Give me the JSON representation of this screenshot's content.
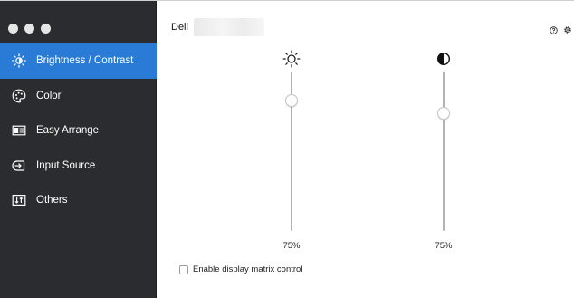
{
  "window": {
    "controls": [
      "close",
      "minimize",
      "zoom"
    ]
  },
  "sidebar": {
    "items": [
      {
        "label": "Brightness / Contrast",
        "icon": "brightness-icon",
        "active": true
      },
      {
        "label": "Color",
        "icon": "palette-icon",
        "active": false
      },
      {
        "label": "Easy Arrange",
        "icon": "easy-arrange-icon",
        "active": false
      },
      {
        "label": "Input Source",
        "icon": "input-source-icon",
        "active": false
      },
      {
        "label": "Others",
        "icon": "others-icon",
        "active": false
      }
    ]
  },
  "header": {
    "brand": "Dell",
    "top_icons": [
      "help-icon",
      "settings-icon"
    ]
  },
  "sliders": {
    "brightness": {
      "icon": "sun-icon",
      "value": 75,
      "value_label": "75%"
    },
    "contrast": {
      "icon": "contrast-icon",
      "value": 75,
      "value_label": "75%"
    }
  },
  "options": {
    "matrix_control": {
      "label": "Enable display matrix control",
      "checked": false
    }
  },
  "colors": {
    "sidebar_bg": "#2b2c2f",
    "accent": "#2a7bd6",
    "track": "#b3b3b3"
  }
}
